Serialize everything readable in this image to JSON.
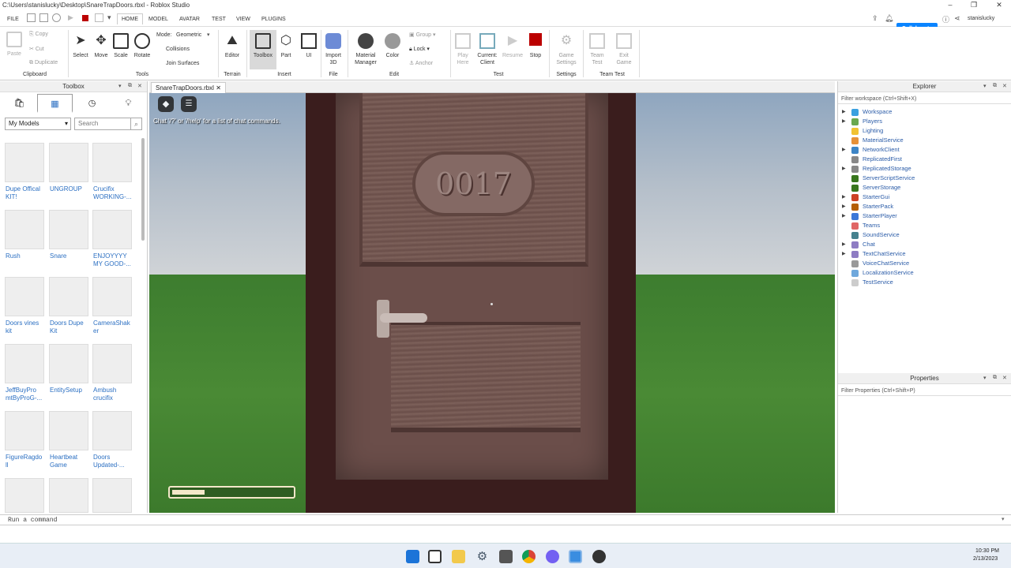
{
  "window": {
    "title": "C:\\Users\\stanislucky\\Desktop\\SnareTrapDoors.rbxl - Roblox Studio"
  },
  "menu": {
    "file": "FILE",
    "tabs": [
      "HOME",
      "MODEL",
      "AVATAR",
      "TEST",
      "VIEW",
      "PLUGINS"
    ]
  },
  "account": {
    "collaborate": "Collaborate",
    "username": "stanislucky"
  },
  "ribbon": {
    "clipboard": {
      "paste": "Paste",
      "copy": "Copy",
      "cut": "Cut",
      "duplicate": "Duplicate",
      "group": "Clipboard"
    },
    "tools": {
      "select": "Select",
      "move": "Move",
      "scale": "Scale",
      "rotate": "Rotate",
      "mode_label": "Mode:",
      "mode_value": "Geometric",
      "collisions": "Collisions",
      "join_surfaces": "Join Surfaces",
      "group": "Tools"
    },
    "terrain": {
      "editor": "Editor",
      "group": "Terrain"
    },
    "insert": {
      "toolbox": "Toolbox",
      "part": "Part",
      "ui": "UI",
      "group": "Insert"
    },
    "file": {
      "import_line1": "Import",
      "import_line2": "3D",
      "group": "File"
    },
    "edit": {
      "material_line1": "Material",
      "material_line2": "Manager",
      "color": "Color",
      "grp": "Group",
      "lock": "Lock",
      "anchor": "Anchor",
      "group": "Edit"
    },
    "test": {
      "play_line1": "Play",
      "play_line2": "Here",
      "current_line1": "Current:",
      "current_line2": "Client",
      "resume": "Resume",
      "stop": "Stop",
      "group": "Test"
    },
    "settings": {
      "game_line1": "Game",
      "game_line2": "Settings",
      "group": "Settings"
    },
    "teamtest": {
      "team_line1": "Team",
      "team_line2": "Test",
      "exit_line1": "Exit",
      "exit_line2": "Game",
      "group": "Team Test"
    }
  },
  "toolbox": {
    "title": "Toolbox",
    "category": "My Models",
    "search_placeholder": "Search",
    "items": [
      {
        "line1": "Dupe Offical",
        "line2": "KIT!"
      },
      {
        "line1": "UNGROUP",
        "line2": ""
      },
      {
        "line1": "Crucifix",
        "line2": "WORKING-..."
      },
      {
        "line1": "Rush",
        "line2": ""
      },
      {
        "line1": "Snare",
        "line2": ""
      },
      {
        "line1": "ENJOYYYY",
        "line2": "MY GOOD-..."
      },
      {
        "line1": "Doors vines",
        "line2": "kit"
      },
      {
        "line1": "Doors Dupe",
        "line2": "Kit"
      },
      {
        "line1": "CameraShak",
        "line2": "er"
      },
      {
        "line1": "JeffBuyPro",
        "line2": "mtByProG-..."
      },
      {
        "line1": "EntitySetup",
        "line2": ""
      },
      {
        "line1": "Ambush",
        "line2": "crucifix"
      },
      {
        "line1": "FigureRagdo",
        "line2": "ll"
      },
      {
        "line1": "Heartbeat",
        "line2": "Game"
      },
      {
        "line1": "Doors",
        "line2": "Updated-..."
      }
    ]
  },
  "document": {
    "tab": "SnareTrapDoors.rbxl"
  },
  "viewport": {
    "chat_hint": "Chat '/?' or '/help' for a list of chat commands.",
    "door_number": "0017",
    "progress": 0.27
  },
  "explorer": {
    "title": "Explorer",
    "filter": "Filter workspace (Ctrl+Shift+X)",
    "items": [
      {
        "name": "Workspace",
        "expand": "▶",
        "color": "#3aa0e0"
      },
      {
        "name": "Players",
        "expand": "▶",
        "color": "#6aa84f"
      },
      {
        "name": "Lighting",
        "expand": "",
        "color": "#f1c232"
      },
      {
        "name": "MaterialService",
        "expand": "",
        "color": "#e69138"
      },
      {
        "name": "NetworkClient",
        "expand": "▶",
        "color": "#3d85c6"
      },
      {
        "name": "ReplicatedFirst",
        "expand": "",
        "color": "#888888"
      },
      {
        "name": "ReplicatedStorage",
        "expand": "▶",
        "color": "#888888"
      },
      {
        "name": "ServerScriptService",
        "expand": "",
        "color": "#38761d"
      },
      {
        "name": "ServerStorage",
        "expand": "",
        "color": "#38761d"
      },
      {
        "name": "StarterGui",
        "expand": "▶",
        "color": "#cc4125"
      },
      {
        "name": "StarterPack",
        "expand": "▶",
        "color": "#b45f06"
      },
      {
        "name": "StarterPlayer",
        "expand": "▶",
        "color": "#3c78d8"
      },
      {
        "name": "Teams",
        "expand": "",
        "color": "#e06666"
      },
      {
        "name": "SoundService",
        "expand": "",
        "color": "#45818e"
      },
      {
        "name": "Chat",
        "expand": "▶",
        "color": "#8e7cc3"
      },
      {
        "name": "TextChatService",
        "expand": "▶",
        "color": "#8e7cc3"
      },
      {
        "name": "VoiceChatService",
        "expand": "",
        "color": "#999999"
      },
      {
        "name": "LocalizationService",
        "expand": "",
        "color": "#6fa8dc"
      },
      {
        "name": "TestService",
        "expand": "",
        "color": "#cccccc"
      }
    ]
  },
  "properties": {
    "title": "Properties",
    "filter": "Filter Properties (Ctrl+Shift+P)"
  },
  "command": {
    "placeholder": "Run a command"
  },
  "taskbar": {
    "time": "10:30 PM",
    "date": "2/13/2023"
  }
}
